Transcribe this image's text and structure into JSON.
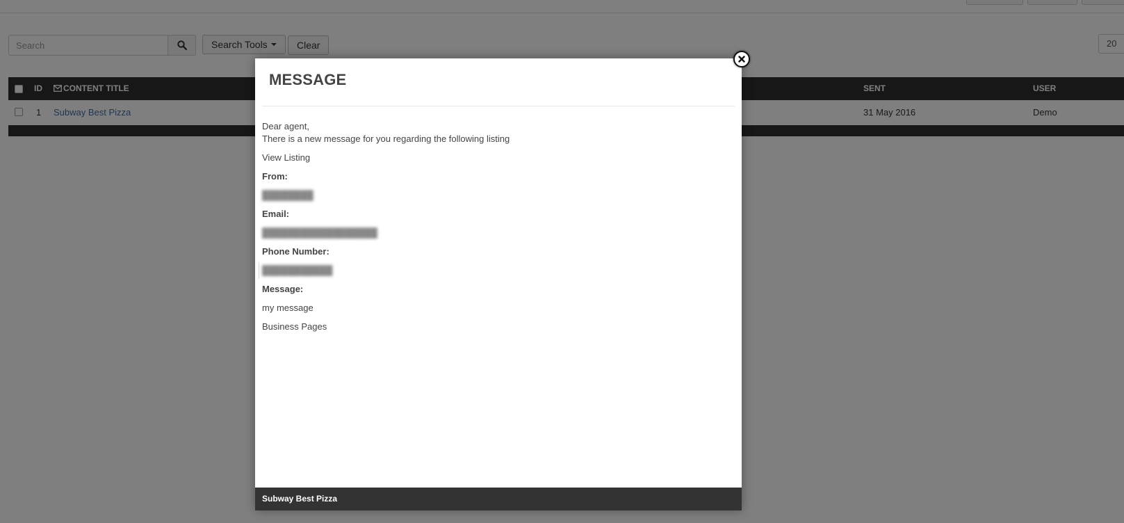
{
  "search": {
    "placeholder": "Search",
    "tools_label": "Search Tools",
    "clear_label": "Clear",
    "limit_value": "20"
  },
  "table": {
    "columns": {
      "id": "ID",
      "content_title": "CONTENT TITLE",
      "sent": "SENT",
      "user": "USER"
    },
    "rows": [
      {
        "id": "1",
        "title": "Subway Best Pizza",
        "sent": "31 May 2016",
        "user": "Demo"
      }
    ]
  },
  "modal": {
    "title": "MESSAGE",
    "greeting": "Dear agent,",
    "intro": "There is a new message for you regarding the following listing",
    "view_listing": "View Listing",
    "from_label": "From:",
    "email_label": "Email:",
    "phone_label": "Phone Number:",
    "message_label": "Message:",
    "message_text": "my message",
    "signature": "Business Pages",
    "footer_title": "Subway Best Pizza"
  }
}
